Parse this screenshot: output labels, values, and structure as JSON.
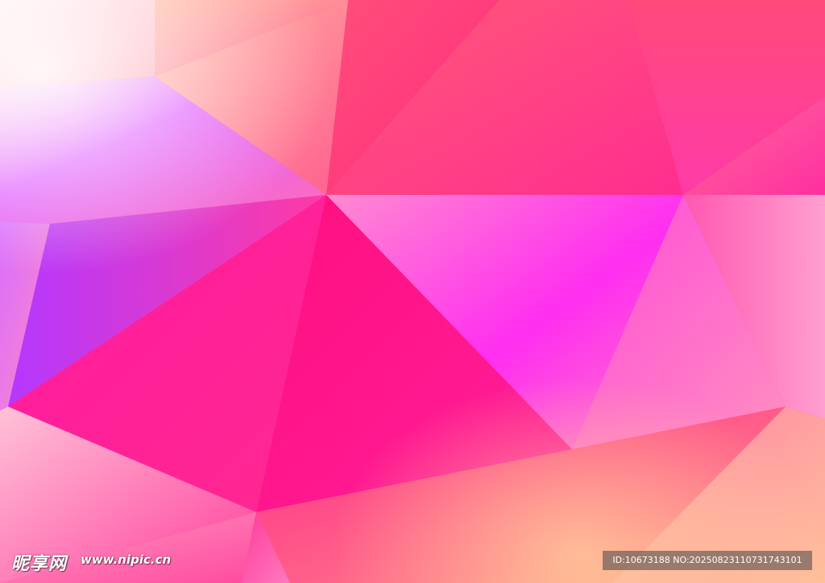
{
  "image": {
    "description_colors": {
      "hot_pink": "#ff1a8c",
      "magenta": "#ff2ee6",
      "peach": "#ffb38a",
      "violet": "#b020ff",
      "light_pink": "#ff8fc4",
      "white_glow": "#ffe8f0"
    }
  },
  "watermark": {
    "logo_text": "昵享网",
    "url_text": "www.nipic.cn",
    "id_text": "ID:10673188 NO:20250823110731743101"
  }
}
